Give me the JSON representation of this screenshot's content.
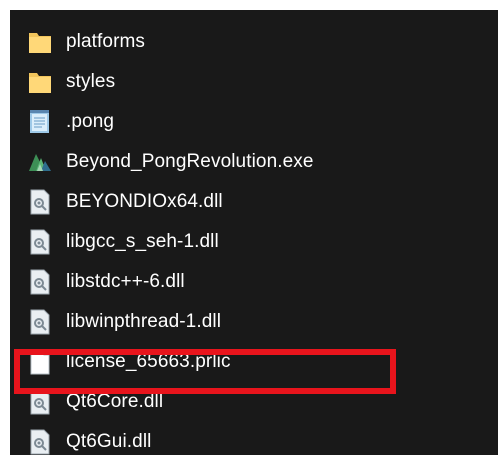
{
  "highlight_color": "#e8141c",
  "files": [
    {
      "name": "platforms",
      "icon": "folder-icon"
    },
    {
      "name": "styles",
      "icon": "folder-icon"
    },
    {
      "name": ".pong",
      "icon": "notepad-file-icon"
    },
    {
      "name": "Beyond_PongRevolution.exe",
      "icon": "exe-app-icon"
    },
    {
      "name": "BEYONDIOx64.dll",
      "icon": "dll-file-icon"
    },
    {
      "name": "libgcc_s_seh-1.dll",
      "icon": "dll-file-icon"
    },
    {
      "name": "libstdc++-6.dll",
      "icon": "dll-file-icon"
    },
    {
      "name": "libwinpthread-1.dll",
      "icon": "dll-file-icon"
    },
    {
      "name": "license_65663.prlic",
      "icon": "blank-file-icon"
    },
    {
      "name": "Qt6Core.dll",
      "icon": "dll-file-icon"
    },
    {
      "name": "Qt6Gui.dll",
      "icon": "dll-file-icon"
    }
  ]
}
